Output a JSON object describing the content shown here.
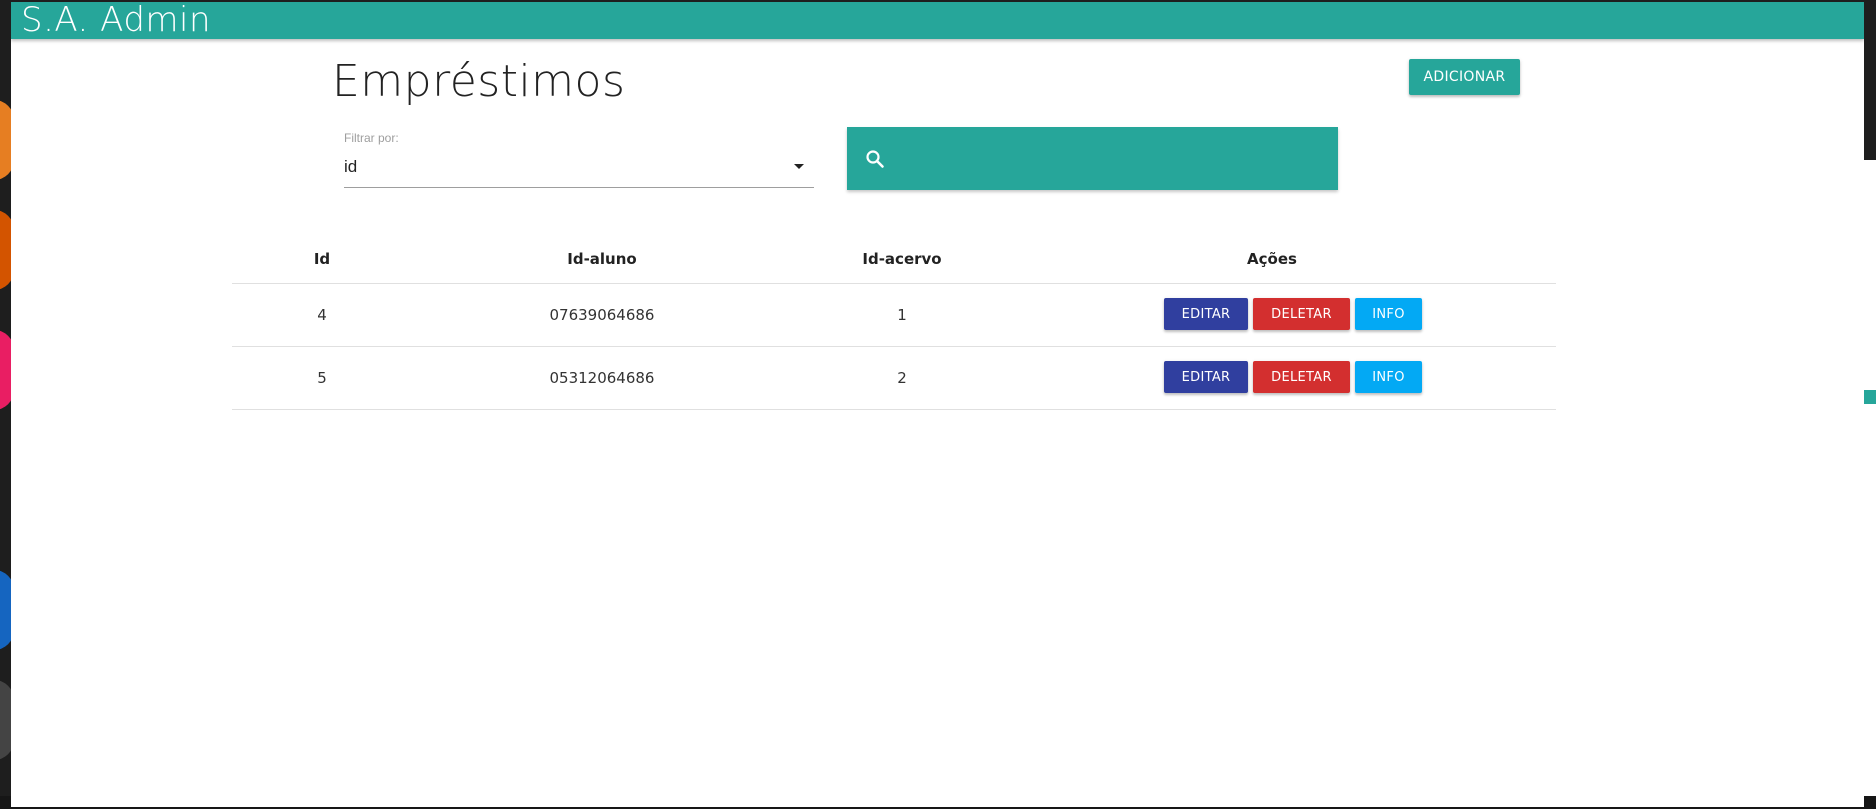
{
  "app": {
    "brand": "S.A. Admin"
  },
  "page": {
    "title": "Empréstimos",
    "add_label": "ADICIONAR"
  },
  "filter": {
    "label": "Filtrar por:",
    "selected": "id"
  },
  "search": {
    "icon": "search-icon",
    "value": "",
    "placeholder": ""
  },
  "table": {
    "headers": [
      "Id",
      "Id-aluno",
      "Id-acervo",
      "Ações"
    ],
    "rows": [
      {
        "id": "4",
        "id_aluno": "07639064686",
        "id_acervo": "1"
      },
      {
        "id": "5",
        "id_aluno": "05312064686",
        "id_acervo": "2"
      }
    ],
    "actions": {
      "edit_label": "EDITAR",
      "delete_label": "DELETAR",
      "info_label": "INFO"
    }
  },
  "colors": {
    "primary": "#26a69a",
    "edit": "#303f9f",
    "delete": "#d32f2f",
    "info": "#03a9f4"
  }
}
